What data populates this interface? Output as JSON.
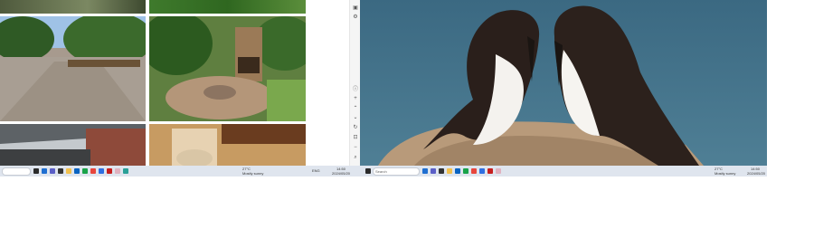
{
  "taskbar_left": {
    "search_placeholder": "",
    "weather_temp": "27°C",
    "weather_text": "Mostly sunny",
    "tray_text": "ENG",
    "clock_time": "14:50",
    "clock_date": "2024/05/20"
  },
  "taskbar_right": {
    "search_placeholder": "Search",
    "weather_temp": "27°C",
    "weather_text": "Mostly sunny",
    "clock_time": "14:50",
    "clock_date": "2024/05/20"
  },
  "icons": {
    "tools": [
      "save-icon",
      "settings-icon",
      "info-icon",
      "zoom-in-icon",
      "chevron-up-icon",
      "chevron-down-icon",
      "rotate-icon",
      "fit-icon",
      "zoom-out-icon",
      "search-icon"
    ]
  },
  "colors": {
    "sea": "#3f6e86",
    "taskbar": "#dfe5ee"
  }
}
